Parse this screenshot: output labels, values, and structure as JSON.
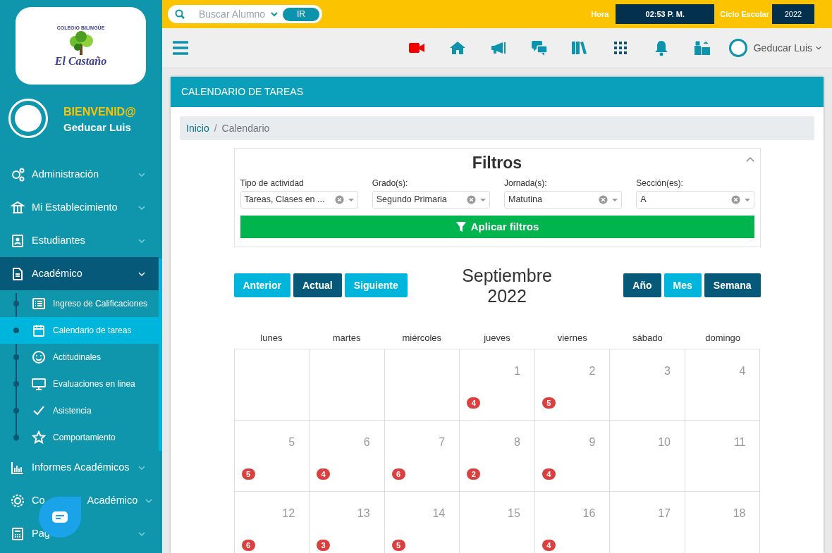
{
  "sidebar": {
    "school_logo": {
      "arc_text": "COLEGIO BILINGÜE",
      "name": "El Castaño"
    },
    "welcome": "BIENVENID@",
    "user": "Geducar Luis",
    "items": [
      {
        "label": "Administración",
        "expanded": false,
        "selected": false
      },
      {
        "label": "Mi Establecimiento",
        "expanded": false,
        "selected": false
      },
      {
        "label": "Estudiantes",
        "expanded": false,
        "selected": false
      },
      {
        "label": "Académico",
        "expanded": true,
        "selected": true,
        "children": [
          {
            "label": "Ingreso de Calificaciones",
            "selected": false
          },
          {
            "label": "Calendario de tareas",
            "selected": true
          },
          {
            "label": "Actitudinales",
            "selected": false
          },
          {
            "label": "Evaluaciones en linea",
            "selected": false
          },
          {
            "label": "Asistencia",
            "selected": false
          },
          {
            "label": "Comportamiento",
            "selected": false
          }
        ]
      },
      {
        "label": "Informes Académicos",
        "expanded": false,
        "selected": false
      },
      {
        "label_parts": [
          "Co",
          "Académico"
        ],
        "expanded": false,
        "selected": false
      },
      {
        "label_parts": [
          "Pag"
        ],
        "expanded": false,
        "selected": false
      }
    ]
  },
  "top_bar": {
    "search": {
      "placeholder": "Buscar Alumno",
      "button": "IR"
    },
    "time_label": "Hora",
    "time": "02:53 P. M.",
    "cycle_label": "Ciclo Escolar",
    "cycle": "2022"
  },
  "nav_bar": {
    "user": "Geducar Luis"
  },
  "page": {
    "title": "CALENDARIO DE TAREAS",
    "breadcrumb": {
      "separator": "/",
      "items": [
        {
          "label": "Inicio",
          "link": true
        },
        {
          "label": "Calendario",
          "link": false
        }
      ]
    },
    "filters": {
      "title": "Filtros",
      "fields": [
        {
          "label": "Tipo de actividad",
          "value": "Tareas, Clases en ..."
        },
        {
          "label": "Grado(s):",
          "value": "Segundo Primaria"
        },
        {
          "label": "Jornada(s):",
          "value": "Matutina"
        },
        {
          "label": "Sección(es):",
          "value": "A"
        }
      ],
      "apply": "Aplicar filtros"
    },
    "nav_buttons": [
      {
        "label": "Anterior",
        "kind": "light"
      },
      {
        "label": "Actual",
        "kind": "dark"
      },
      {
        "label": "Siguiente",
        "kind": "light"
      }
    ],
    "month": "Septiembre",
    "year": "2022",
    "view_buttons": [
      {
        "label": "Año",
        "selected": false
      },
      {
        "label": "Mes",
        "selected": true
      },
      {
        "label": "Semana",
        "selected": false
      }
    ],
    "calendar": {
      "weekdays": [
        "lunes",
        "martes",
        "miércoles",
        "jueves",
        "viernes",
        "sábado",
        "domingo"
      ],
      "weeks": [
        [
          {
            "day": "1",
            "count": "4"
          },
          {
            "day": "2",
            "count": "5"
          },
          {
            "day": "3"
          },
          {
            "day": "4"
          }
        ],
        [
          {
            "day": "5",
            "count": "5"
          },
          {
            "day": "6",
            "count": "4"
          },
          {
            "day": "7",
            "count": "6"
          },
          {
            "day": "8",
            "count": "2"
          },
          {
            "day": "9",
            "count": "4"
          },
          {
            "day": "10"
          },
          {
            "day": "11"
          }
        ],
        [
          {
            "day": "12",
            "count": "6"
          },
          {
            "day": "13",
            "count": "3"
          },
          {
            "day": "14",
            "count": "5"
          },
          {
            "day": "15"
          },
          {
            "day": "16",
            "count": "4"
          },
          {
            "day": "17"
          },
          {
            "day": "18"
          }
        ]
      ]
    }
  }
}
